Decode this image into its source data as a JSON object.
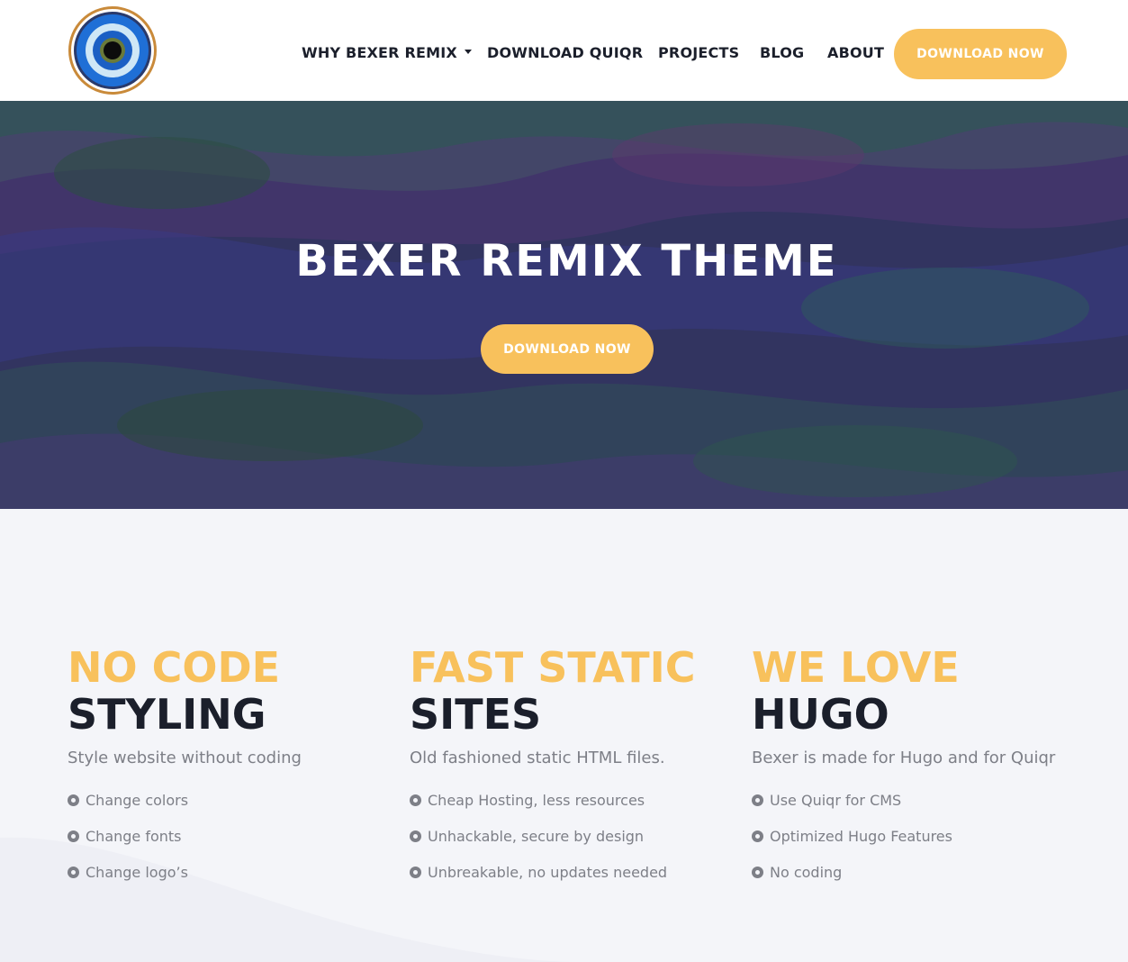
{
  "header": {
    "logo_icon": "eye-logo-icon",
    "nav": [
      {
        "label": "WHY BEXER REMIX",
        "has_dropdown": true
      },
      {
        "label": "DOWNLOAD QUIQR"
      },
      {
        "label": "PROJECTS"
      },
      {
        "label": "BLOG"
      },
      {
        "label": "ABOUT"
      }
    ],
    "cta_label": "DOWNLOAD NOW"
  },
  "hero": {
    "title": "BEXER REMIX THEME",
    "cta_label": "DOWNLOAD NOW"
  },
  "features": [
    {
      "title_accent": "NO CODE",
      "title_main": "STYLING",
      "subtitle": "Style website without coding",
      "items": [
        "Change colors",
        "Change fonts",
        "Change logo’s"
      ]
    },
    {
      "title_accent": "FAST STATIC",
      "title_main": "SITES",
      "subtitle": "Old fashioned static HTML files.",
      "items": [
        "Cheap Hosting, less resources",
        "Unhackable, secure by design",
        "Unbreakable, no updates needed"
      ]
    },
    {
      "title_accent": "WE LOVE",
      "title_main": "HUGO",
      "subtitle": "Bexer is made for Hugo and for Quiqr",
      "items": [
        "Use Quiqr for CMS",
        "Optimized Hugo Features",
        "No coding"
      ]
    }
  ],
  "colors": {
    "accent": "#f8c15c",
    "dark": "#1b1f2b",
    "muted": "#7d7f87",
    "section_bg": "#f4f5f9"
  }
}
